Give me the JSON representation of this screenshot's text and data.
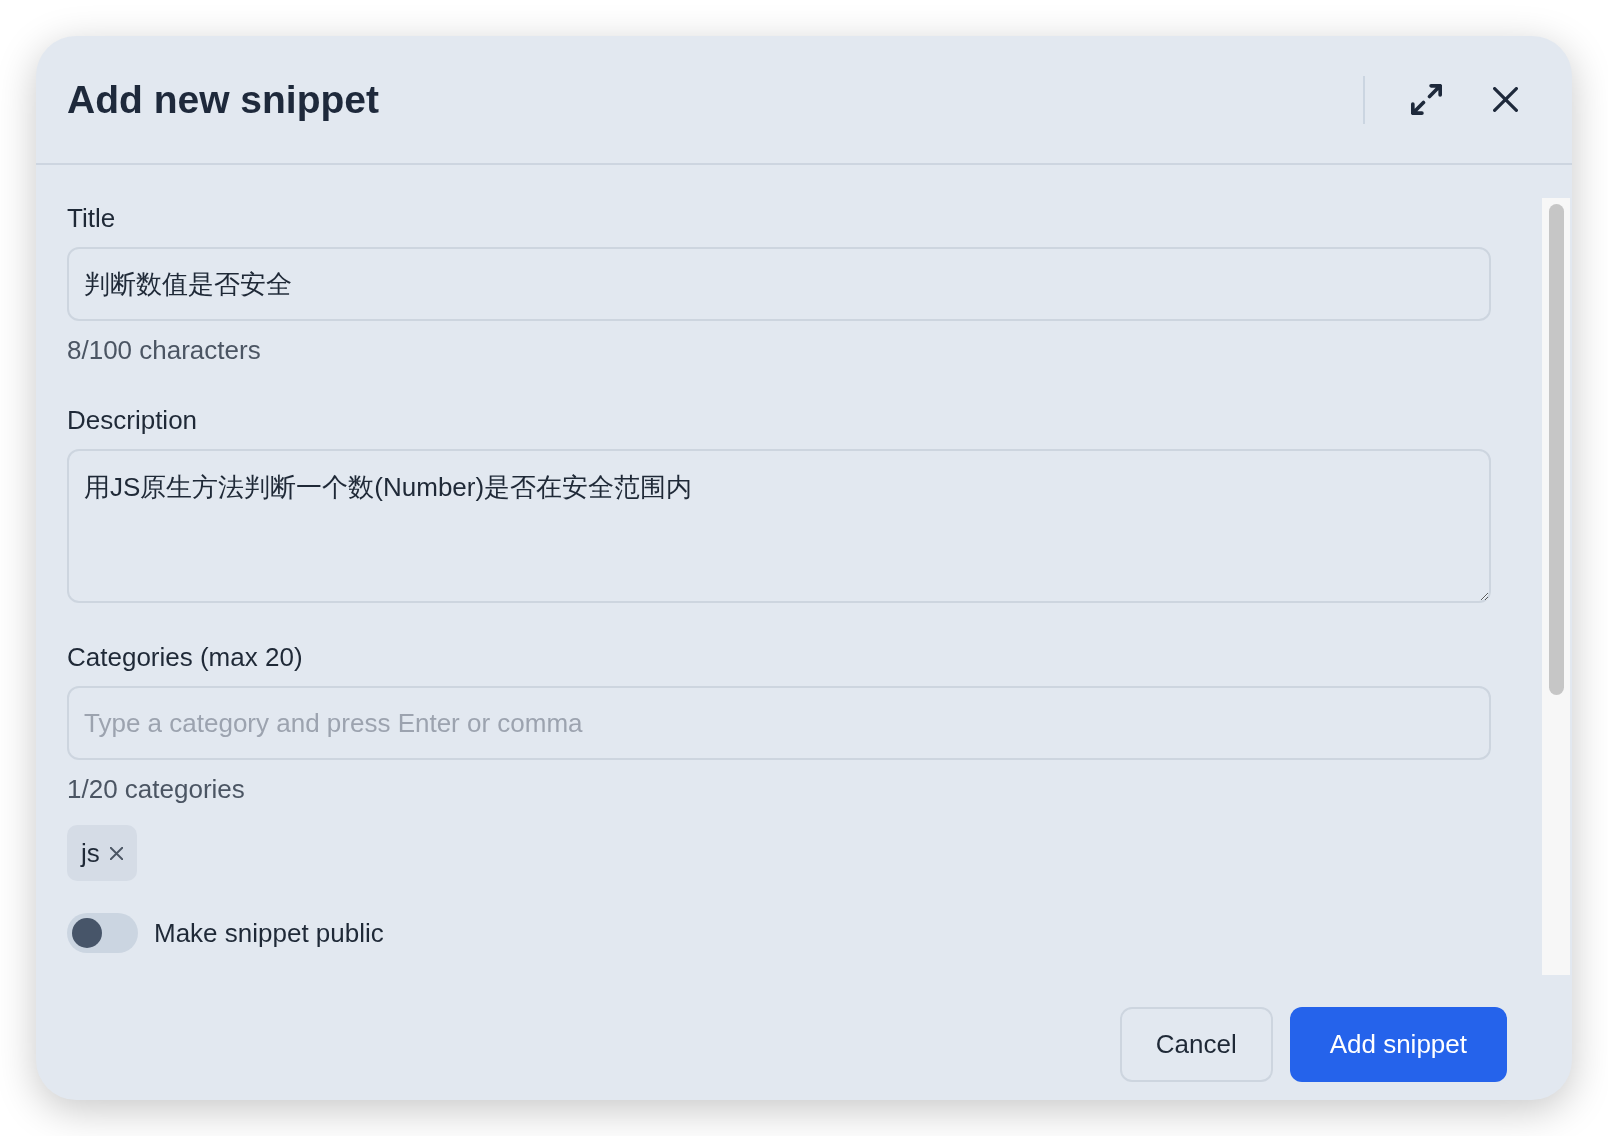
{
  "dialog": {
    "title": "Add new snippet"
  },
  "fields": [
    {
      "kind": "input",
      "label": "Title",
      "value": "判断数值是否安全",
      "helper": "8/100 characters"
    },
    {
      "kind": "textarea",
      "label": "Description",
      "value": "用JS原生方法判断一个数(Number)是否在安全范围内"
    },
    {
      "kind": "input",
      "label": "Categories (max 20)",
      "placeholder": "Type a category and press Enter or comma",
      "helper": "1/20 categories"
    }
  ],
  "categories": [
    {
      "label": "js"
    }
  ],
  "public_toggle": {
    "label": "Make snippet public",
    "on": false
  },
  "buttons": [
    {
      "label": "Cancel",
      "kind": "secondary"
    },
    {
      "label": "Add snippet",
      "kind": "primary"
    }
  ]
}
